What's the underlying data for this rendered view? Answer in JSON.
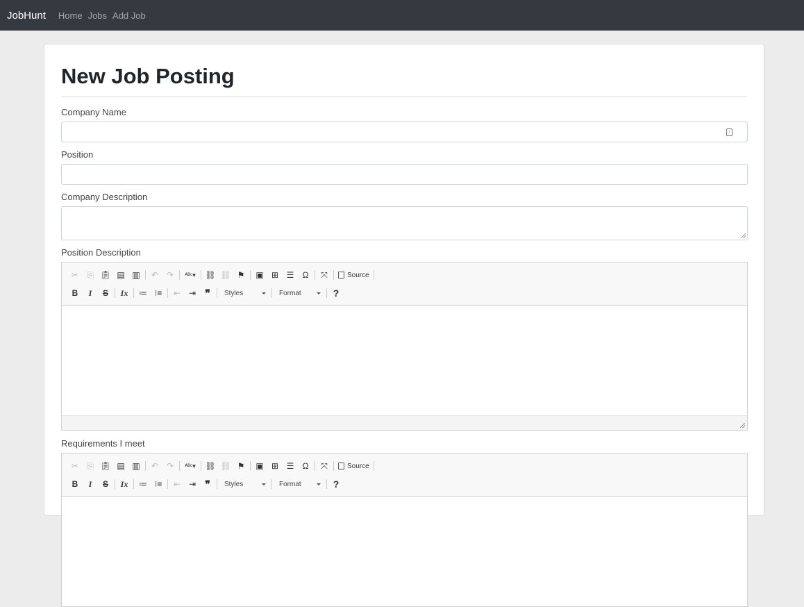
{
  "nav": {
    "brand": "JobHunt",
    "links": [
      "Home",
      "Jobs",
      "Add Job"
    ]
  },
  "page": {
    "title": "New Job Posting"
  },
  "form": {
    "company_name_label": "Company Name",
    "company_name_value": "",
    "position_label": "Position",
    "position_value": "",
    "company_description_label": "Company Description",
    "company_description_value": "",
    "position_description_label": "Position Description",
    "requirements_label": "Requirements I meet"
  },
  "editor_toolbar": {
    "row1_icons": [
      "cut-icon",
      "copy-icon",
      "paste-icon",
      "paste-text-icon",
      "paste-word-icon",
      "undo-icon",
      "redo-icon",
      "spellcheck-icon",
      "link-icon",
      "unlink-icon",
      "anchor-icon",
      "image-icon",
      "table-icon",
      "horizontal-rule-icon",
      "special-char-icon",
      "maximize-icon",
      "source-icon"
    ],
    "source_label": "Source",
    "bold": "B",
    "italic": "I",
    "strike": "S",
    "styles_label": "Styles",
    "format_label": "Format",
    "help": "?"
  },
  "colors": {
    "navbar_bg": "#343a40",
    "page_bg": "#ececec",
    "toolbar_bg": "#f8f8f8"
  }
}
